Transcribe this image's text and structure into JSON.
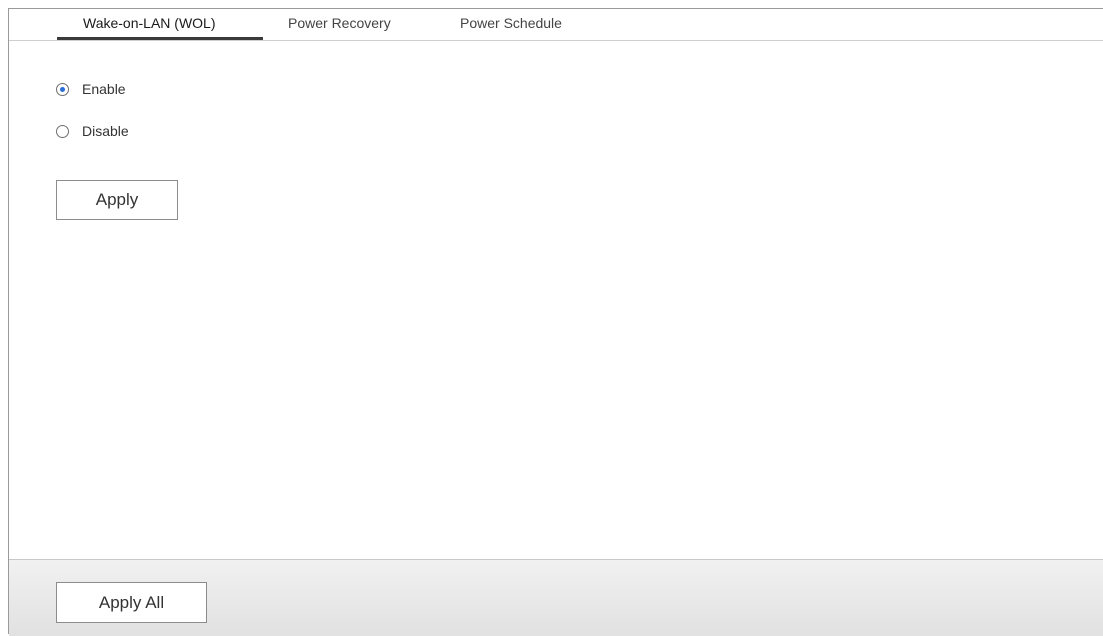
{
  "tabs": [
    {
      "label": "Wake-on-LAN (WOL)",
      "active": true
    },
    {
      "label": "Power Recovery",
      "active": false
    },
    {
      "label": "Power Schedule",
      "active": false
    }
  ],
  "wol": {
    "options": [
      {
        "label": "Enable",
        "checked": true
      },
      {
        "label": "Disable",
        "checked": false
      }
    ],
    "apply_label": "Apply"
  },
  "footer": {
    "apply_all_label": "Apply All"
  },
  "colors": {
    "radio_selected": "#2a6fd6",
    "active_tab_underline": "#3a3a3a",
    "footer_bg": "#e8e8e8"
  }
}
